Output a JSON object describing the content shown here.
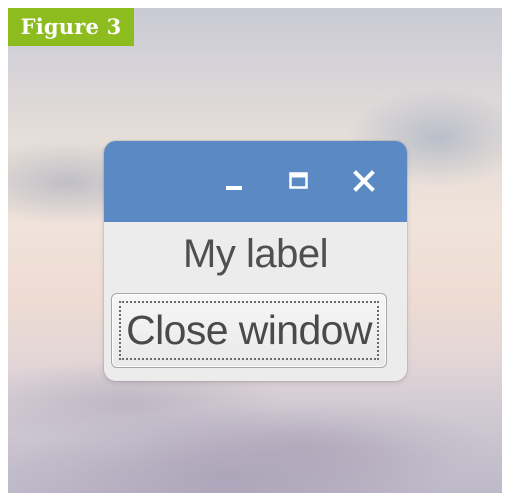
{
  "figure": {
    "badge": "Figure 3",
    "badge_color": "#8cbc1e"
  },
  "window": {
    "titlebar_color": "#5a89c4",
    "controls": [
      {
        "name": "minimize",
        "icon": "minimize-icon"
      },
      {
        "name": "maximize",
        "icon": "maximize-icon"
      },
      {
        "name": "close",
        "icon": "close-icon"
      }
    ],
    "label": "My label",
    "button_label": "Close window"
  }
}
